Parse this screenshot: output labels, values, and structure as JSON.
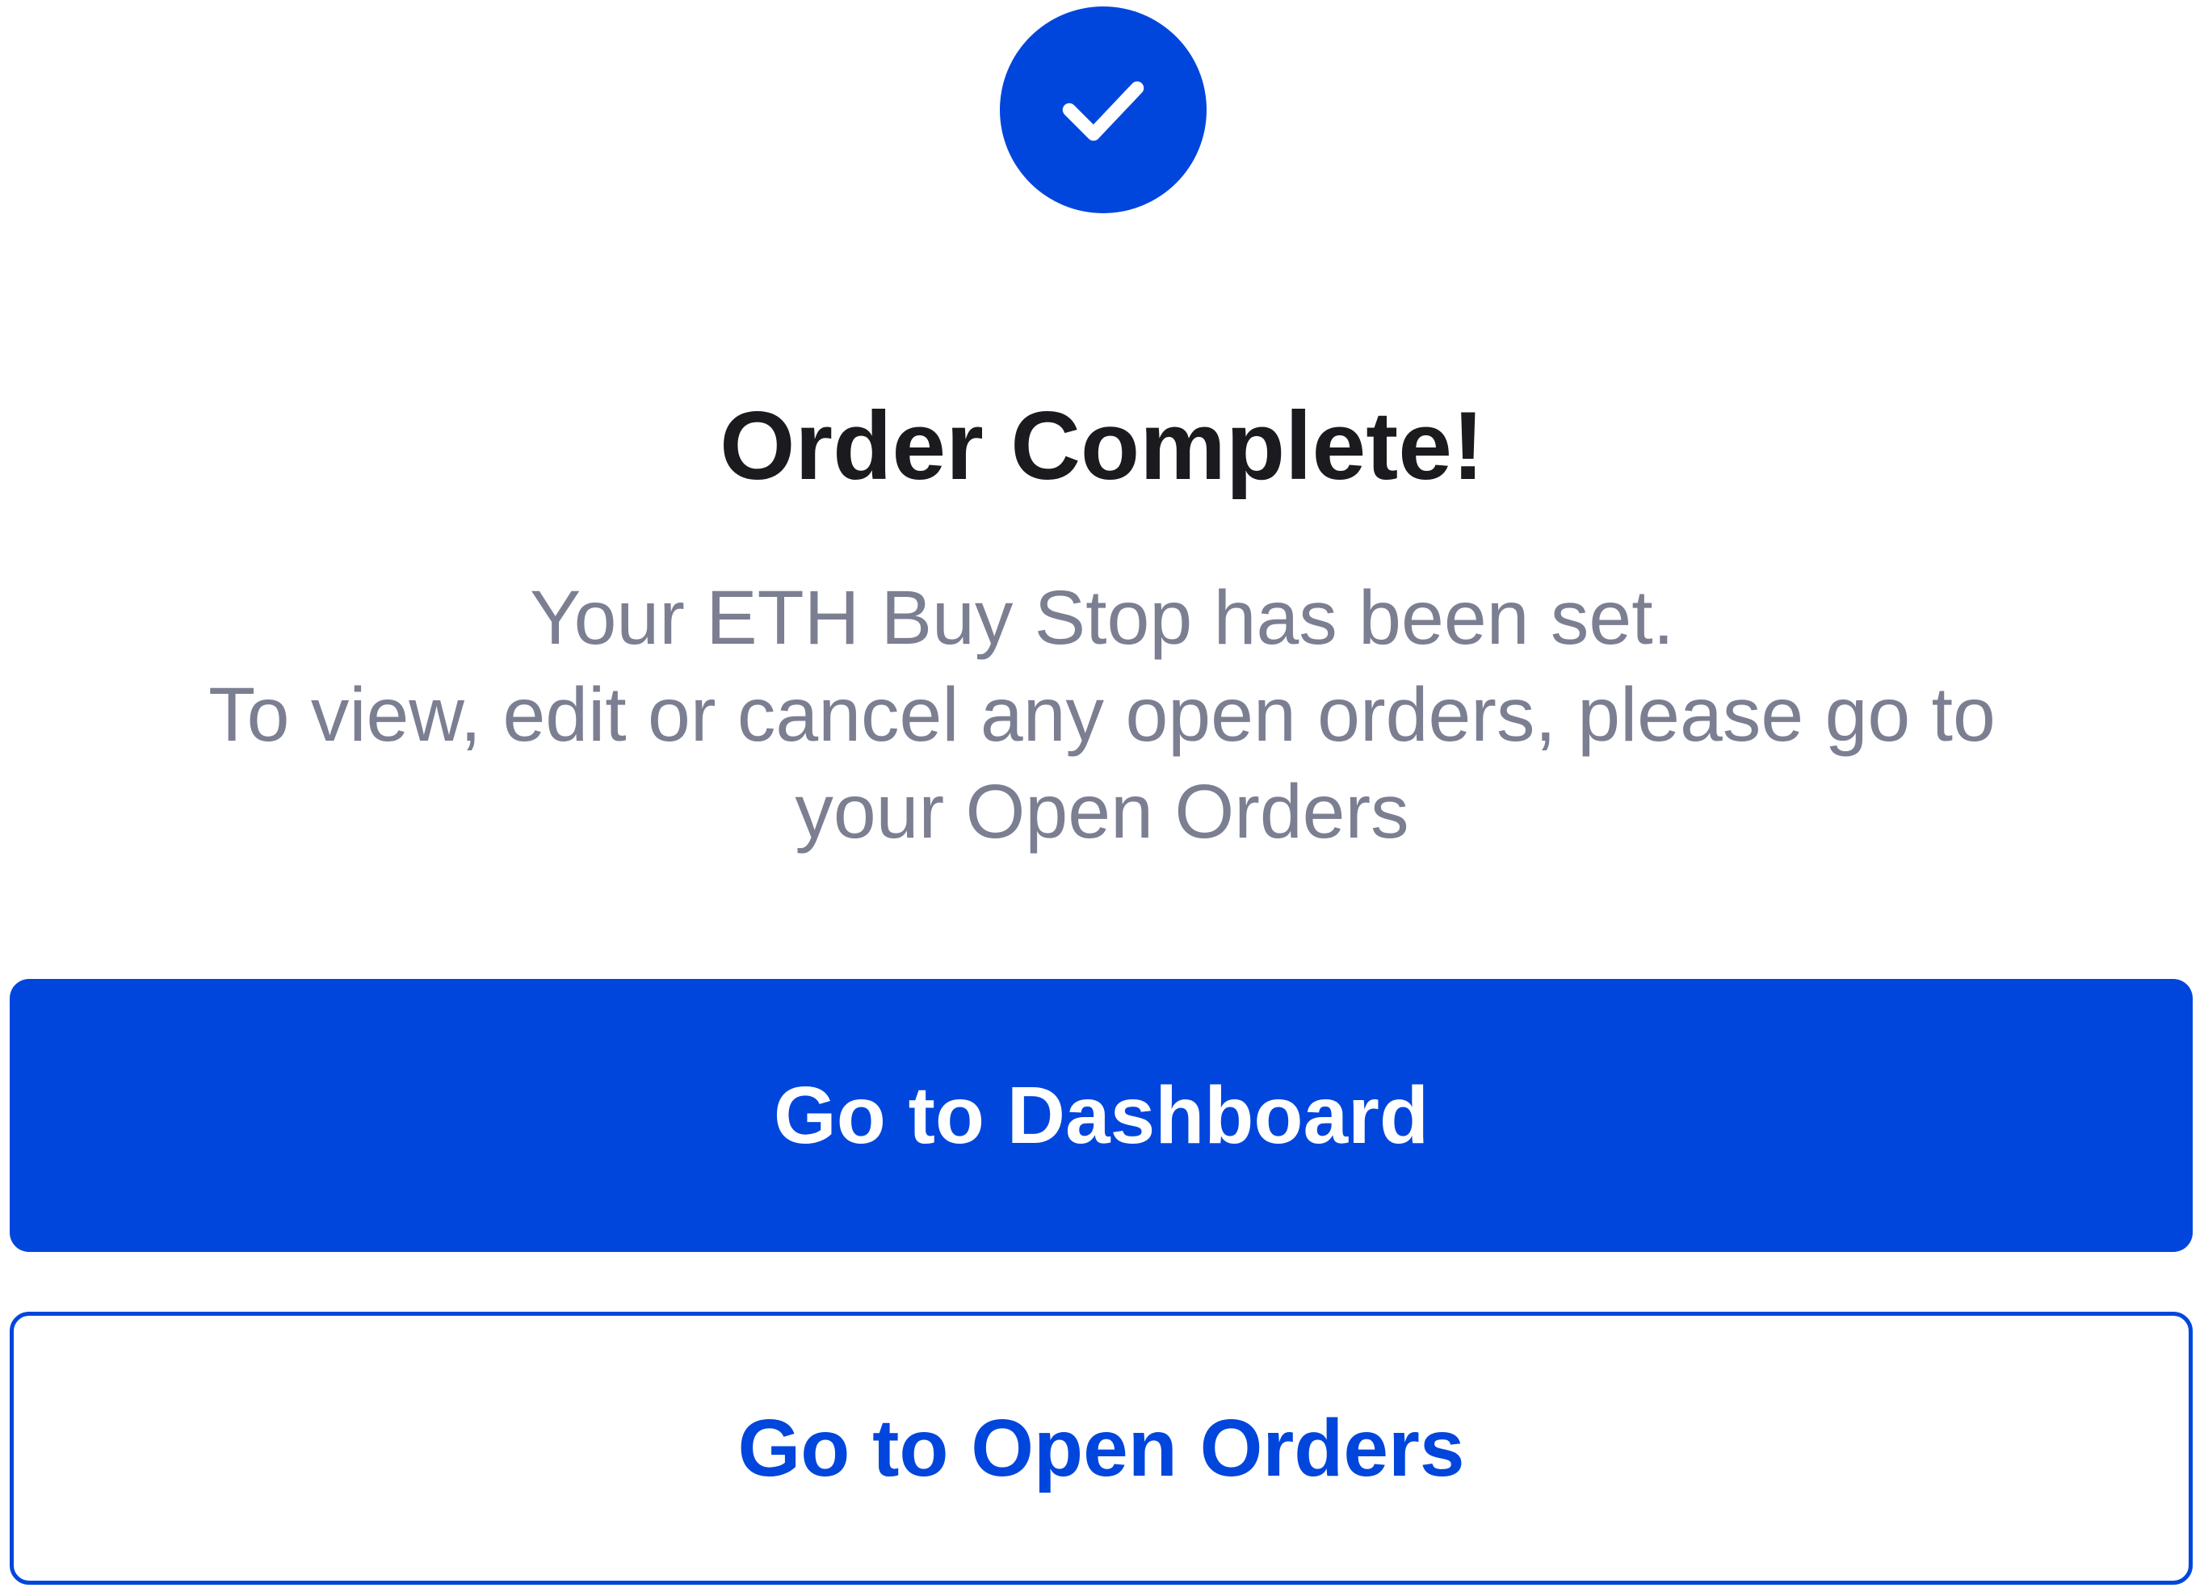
{
  "icon": {
    "name": "checkmark-icon",
    "color": "#0046dd"
  },
  "title": "Order Complete!",
  "message": {
    "line1": "Your ETH Buy Stop has been set.",
    "line2": "To view, edit or cancel any open orders, please go to",
    "line3": "your Open Orders"
  },
  "buttons": {
    "dashboard_label": "Go to Dashboard",
    "open_orders_label": "Go to Open Orders"
  },
  "colors": {
    "accent": "#0046dd",
    "title_text": "#1b1b1f",
    "body_text": "#7b7f91"
  }
}
